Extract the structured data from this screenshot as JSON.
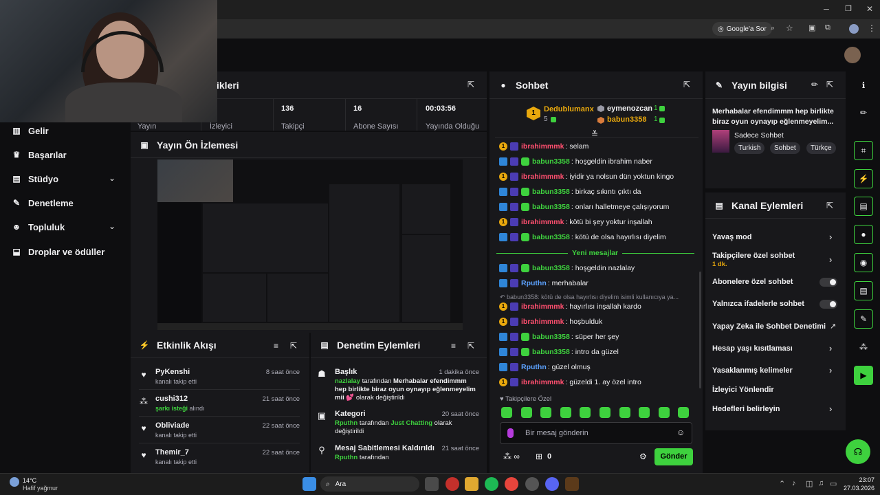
{
  "browser": {
    "google_ask": "Google'a Sor"
  },
  "nav": {
    "items": [
      {
        "label": "Gelir",
        "icon": "bar-chart-icon"
      },
      {
        "label": "Başarılar",
        "icon": "trophy-icon"
      },
      {
        "label": "Stüdyo",
        "icon": "studio-icon"
      },
      {
        "label": "Denetleme",
        "icon": "wrench-icon"
      },
      {
        "label": "Topluluk",
        "icon": "community-icon"
      },
      {
        "label": "Droplar ve ödüller",
        "icon": "drops-icon"
      }
    ]
  },
  "stats": {
    "title_partial": "ikleri",
    "items": [
      {
        "value": "",
        "label": "Yayın"
      },
      {
        "value": "",
        "label": "İzleyici"
      },
      {
        "value": "136",
        "label": "Takipçi"
      },
      {
        "value": "16",
        "label": "Abone Sayısı"
      },
      {
        "value": "00:03:56",
        "label": "Yayında Olduğu"
      }
    ]
  },
  "preview": {
    "title": "Yayın Ön İzlemesi"
  },
  "activity": {
    "title": "Etkinlik Akışı",
    "items": [
      {
        "name": "PyKenshi",
        "sub": "kanalı takip etti",
        "time": "8 saat önce",
        "icon": "heart-icon"
      },
      {
        "name": "cushi312",
        "sub_prefix": "şarkı isteği",
        "sub": " alındı",
        "time": "21 saat önce",
        "icon": "dots-icon"
      },
      {
        "name": "Obliviade",
        "sub": "kanalı takip etti",
        "time": "22 saat önce",
        "icon": "heart-icon"
      },
      {
        "name": "Themir_7",
        "sub": "kanalı takip etti",
        "time": "22 saat önce",
        "icon": "heart-icon"
      }
    ]
  },
  "modlog": {
    "title": "Denetim Eylemleri",
    "items": [
      {
        "title": "Başlık",
        "time": "1 dakika önce",
        "user": "nazlalay",
        "by": " tarafından ",
        "value": "Merhabalar efendimmm hep birlikte biraz oyun oynayıp eğlenmeyelim mii 💕",
        "suffix": "olarak değiştirildi"
      },
      {
        "title": "Kategori",
        "time": "20 saat önce",
        "user": "Rputhn",
        "by": " tarafından ",
        "value": "Just Chatting",
        "suffix": " olarak değiştirildi"
      },
      {
        "title": "Mesaj Sabitlemesi Kaldırıldı",
        "time": "21 saat önce",
        "user": "Rputhn",
        "by": " tarafından",
        "value": "",
        "suffix": ""
      }
    ]
  },
  "chat": {
    "title": "Sohbet",
    "leaders": [
      {
        "name": "Dedublumanx",
        "count": "5"
      },
      {
        "name": "eymenozcan",
        "count": "1"
      },
      {
        "name": "babun3358",
        "count": "1"
      }
    ],
    "messages": [
      {
        "user": "ibrahimmmk",
        "color": "#ff4f6f",
        "badges": [
          "vip",
          "star"
        ],
        "text": "selam"
      },
      {
        "user": "babun3358",
        "color": "#3ed13e",
        "badges": [
          "ver",
          "star",
          "green"
        ],
        "text": "hoşgeldin ibrahim naber"
      },
      {
        "user": "ibrahimmmk",
        "color": "#ff4f6f",
        "badges": [
          "vip",
          "star"
        ],
        "text": "iyidir ya nolsun dün yoktun kingo"
      },
      {
        "user": "babun3358",
        "color": "#3ed13e",
        "badges": [
          "ver",
          "star",
          "green"
        ],
        "text": "birkaç sıkıntı çıktı da"
      },
      {
        "user": "babun3358",
        "color": "#3ed13e",
        "badges": [
          "ver",
          "star",
          "green"
        ],
        "text": "onları halletmeye çalışıyorum"
      },
      {
        "user": "ibrahimmmk",
        "color": "#ff4f6f",
        "badges": [
          "vip",
          "star"
        ],
        "text": "kötü bi şey yoktur inşallah"
      },
      {
        "user": "babun3358",
        "color": "#3ed13e",
        "badges": [
          "ver",
          "star",
          "green"
        ],
        "text": "kötü de olsa hayırlısı diyelim"
      }
    ],
    "new_messages": "Yeni mesajlar",
    "messages2": [
      {
        "user": "babun3358",
        "color": "#3ed13e",
        "badges": [
          "ver",
          "star",
          "green"
        ],
        "text": "hoşgeldin nazlalay"
      },
      {
        "user": "Rputhn",
        "color": "#5ca2ff",
        "badges": [
          "ver",
          "star"
        ],
        "text": "merhabalar"
      }
    ],
    "reply_ref": "babun3358: kötü de olsa hayırlısı diyelim isimli kullanıcıya ya...",
    "messages3": [
      {
        "user": "ibrahimmmk",
        "color": "#ff4f6f",
        "badges": [
          "vip",
          "star"
        ],
        "text": "hayırlısı inşallah kardo"
      },
      {
        "user": "ibrahimmmk",
        "color": "#ff4f6f",
        "badges": [
          "vip",
          "star"
        ],
        "text": "hoşbulduk"
      },
      {
        "user": "babun3358",
        "color": "#3ed13e",
        "badges": [
          "ver",
          "star",
          "green"
        ],
        "text": "süper her şey"
      },
      {
        "user": "babun3358",
        "color": "#3ed13e",
        "badges": [
          "ver",
          "star",
          "green"
        ],
        "text": "intro da güzel"
      },
      {
        "user": "Rputhn",
        "color": "#5ca2ff",
        "badges": [
          "ver",
          "star"
        ],
        "text": "güzel olmuş"
      },
      {
        "user": "ibrahimmmk",
        "color": "#ff4f6f",
        "badges": [
          "vip",
          "star"
        ],
        "text": "güzeldi 1. ay özel intro"
      }
    ],
    "followers_only": "Takipçilere Özel",
    "input_placeholder": "Bir mesaj gönderin",
    "points": "0",
    "send": "Gönder"
  },
  "streaminfo": {
    "title": "Yayın bilgisi",
    "stream_title": "Merhabalar efendimmm hep birlikte biraz oyun oynayıp eğlenmeyelim...",
    "category": "Sadece Sohbet",
    "tags": [
      "Turkish",
      "Sohbet",
      "Türkçe"
    ]
  },
  "channel_actions": {
    "title": "Kanal Eylemleri",
    "items": [
      {
        "label": "Yavaş mod",
        "control": "chevron"
      },
      {
        "label": "Takipçilere özel sohbet",
        "sub": "1 dk.",
        "control": "chevron"
      },
      {
        "label": "Abonelere özel sohbet",
        "control": "toggle"
      },
      {
        "label": "Yalnızca ifadelerle sohbet",
        "control": "toggle"
      },
      {
        "label": "Yapay Zeka ile Sohbet Denetimi",
        "control": "external"
      },
      {
        "label": "Hesap yaşı kısıtlaması",
        "control": "chevron"
      },
      {
        "label": "Yasaklanmış kelimeler",
        "control": "chevron"
      },
      {
        "label": "İzleyici Yönlendir",
        "control": "none"
      },
      {
        "label": "Hedefleri belirleyin",
        "control": "chevron"
      }
    ]
  },
  "taskbar": {
    "weather_temp": "14°C",
    "weather_desc": "Hafif yağmur",
    "search": "Ara",
    "time": "23:07",
    "date": "27.03.2026"
  },
  "colors": {
    "accent": "#3ed13e",
    "bg": "#0e0e10",
    "panel": "#18181b"
  }
}
